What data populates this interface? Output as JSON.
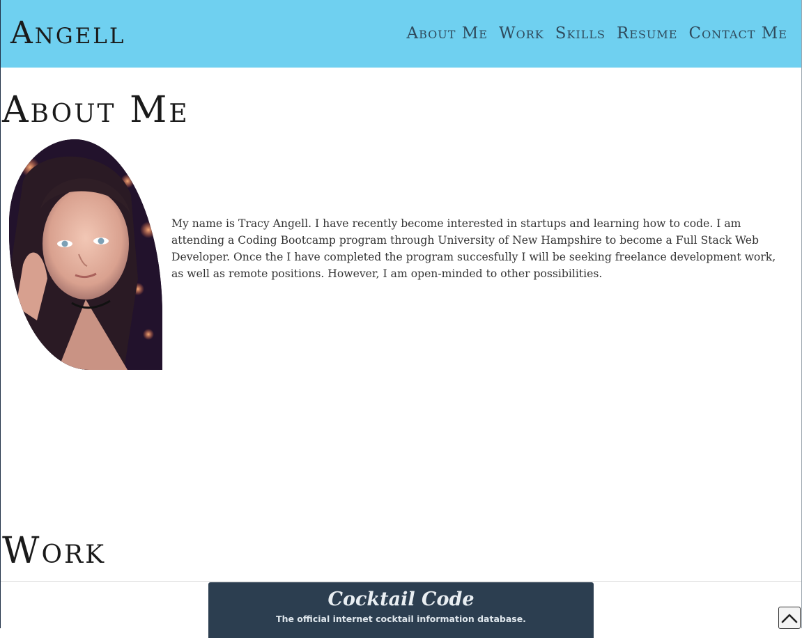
{
  "brand": "Angell",
  "nav": [
    "About Me",
    "Work",
    "Skills",
    "Resume",
    "Contact Me"
  ],
  "sections": {
    "about": {
      "title": "About Me",
      "bio": "My name is Tracy Angell. I have recently become interested in startups and learning how to code. I am attending a Coding Bootcamp program through University of New Hampshire to become a Full Stack Web Developer. Once the I have completed the program succesfully I will be seeking freelance development work, as well as remote positions. However, I am open-minded to other possibilities."
    },
    "work": {
      "title": "Work",
      "projects": [
        {
          "title": "Cocktail Code",
          "subtitle": "The official internet cocktail information database."
        }
      ]
    }
  },
  "colors": {
    "header_bg": "#6fd0f0",
    "project_card_bg": "#2c3e50",
    "nav_text": "#2f4a5c"
  },
  "icons": {
    "scroll_top": "chevron-up-icon"
  }
}
